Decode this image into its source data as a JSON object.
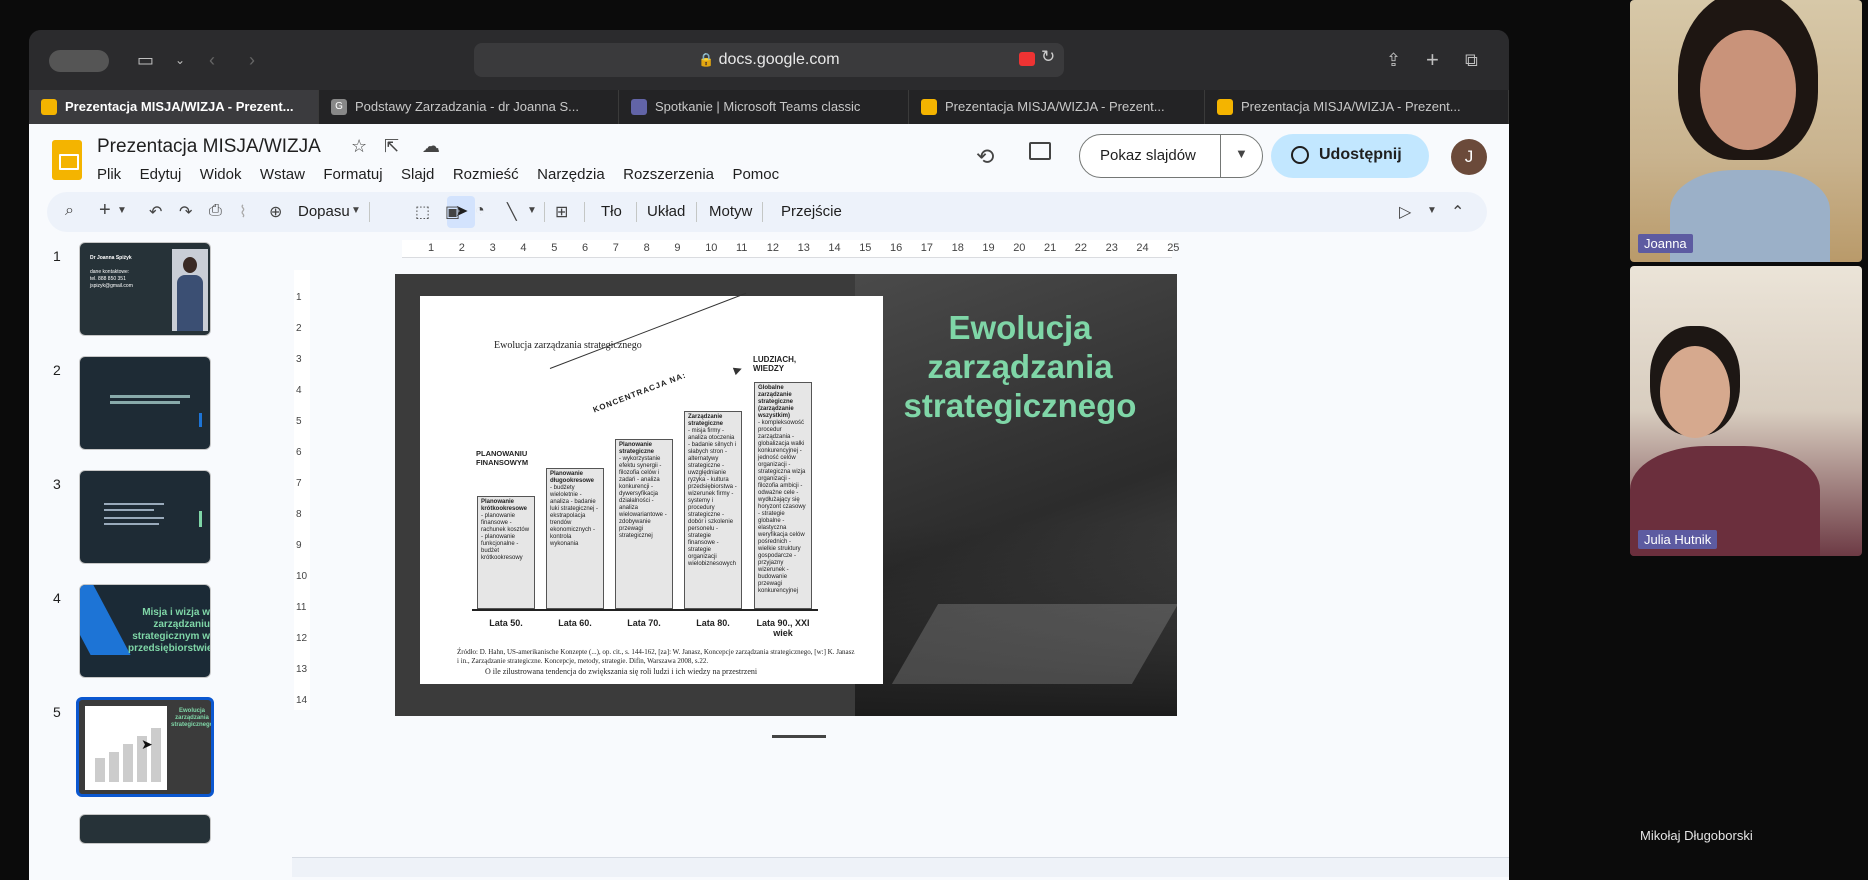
{
  "browser": {
    "url": "docs.google.com",
    "tabs": [
      {
        "label": "Prezentacja MISJA/WIZJA - Prezent...",
        "icon": "slides-icon",
        "active": true
      },
      {
        "label": "Podstawy Zarzadzania - dr Joanna S...",
        "icon": "g-icon",
        "active": false
      },
      {
        "label": "Spotkanie | Microsoft Teams classic",
        "icon": "teams-icon",
        "active": false
      },
      {
        "label": "Prezentacja MISJA/WIZJA - Prezent...",
        "icon": "slides-icon",
        "active": false
      },
      {
        "label": "Prezentacja MISJA/WIZJA - Prezent...",
        "icon": "slides-icon",
        "active": false
      }
    ]
  },
  "docs": {
    "title": "Prezentacja MISJA/WIZJA",
    "menu": [
      "Plik",
      "Edytuj",
      "Widok",
      "Wstaw",
      "Formatuj",
      "Slajd",
      "Rozmieść",
      "Narzędzia",
      "Rozszerzenia",
      "Pomoc"
    ],
    "slideshow_label": "Pokaz slajdów",
    "share_label": "Udostępnij",
    "avatar_initial": "J",
    "toolbar": {
      "zoom": "Dopasu",
      "background": "Tło",
      "layout": "Układ",
      "theme": "Motyw",
      "transition": "Przejście"
    }
  },
  "filmstrip": {
    "numbers": [
      "1",
      "2",
      "3",
      "4",
      "5"
    ],
    "slide1": {
      "name": "Dr Joanna Spiżyk",
      "contact_label": "dane kontaktowe:",
      "phone": "tel. 888 850 351",
      "email": "jspizyk@gmail.com"
    },
    "slide4": {
      "title": "Misja i wizja w zarządzaniu strategicznym w przedsiębiorstwie"
    },
    "slide5": {
      "title": "Ewolucja zarządzania strategicznego"
    }
  },
  "ruler": {
    "top": [
      "1",
      "2",
      "3",
      "4",
      "5",
      "6",
      "7",
      "8",
      "9",
      "10",
      "11",
      "12",
      "13",
      "14",
      "15",
      "16",
      "17",
      "18",
      "19",
      "20",
      "21",
      "22",
      "23",
      "24",
      "25"
    ],
    "left": [
      "1",
      "2",
      "3",
      "4",
      "5",
      "6",
      "7",
      "8",
      "9",
      "10",
      "11",
      "12",
      "13",
      "14"
    ]
  },
  "slide": {
    "title": "Ewolucja zarządzania strategicznego",
    "scan": {
      "heading": "Ewolucja zarządzania strategicznego",
      "top_right": "LUDZIACH, WIEDZY",
      "arrow_label": "KONCENTRACJA NA:",
      "left_label": "PLANOWANIU FINANSOWYM",
      "columns": [
        {
          "title": "Planowanie krótkookresowe",
          "items": "- planowanie finansowe - rachunek kosztów - planowanie funkcjonalne - budżet krótkookresowy",
          "era": "Lata 50."
        },
        {
          "title": "Planowanie długookresowe",
          "items": "- budżety wieloletnie - analiza - badanie luki strategicznej - ekstrapolacja trendów ekonomicznych - kontrola wykonania",
          "era": "Lata 60."
        },
        {
          "title": "Planowanie strategiczne",
          "items": "- wykorzystanie efektu synergii - filozofia celów i zadań - analiza konkurencji - dywersyfikacja działalności - analiza wielowariantowe - zdobywanie przewagi strategicznej",
          "era": "Lata 70."
        },
        {
          "title": "Zarządzanie strategiczne",
          "items": "- misja firmy - analiza otoczenia - badanie silnych i słabych stron - alternatywy strategiczne - uwzględnianie ryzyka - kultura przedsiębiorstwa - wizerunek firmy - systemy i procedury strategiczne - dobór i szkolenie personelu - strategie finansowe - strategie organizacji wielobiznesowych",
          "era": "Lata 80."
        },
        {
          "title": "Globalne zarządzanie strategiczne (zarządzanie wszystkim)",
          "items": "- kompleksowość procedur zarządzania - globalizacja walki konkurencyjnej - jedność celów organizacji - strategiczna wizja organizacji - filozofia ambicji - odważne cele - wydłużający się horyzont czasowy - strategie globalne - elastyczna weryfikacja celów pośrednich - wielkie struktury gospodarcze - przyjazny wizerunek - budowanie przewagi konkurencyjnej",
          "era": "Lata 90., XXI wiek"
        }
      ],
      "source": "Źródło: D. Hahn, US-amerikanische Konzepte (...), op. cit., s. 144-162, [za]: W. Janasz, Koncepcje zarządzania strategicznego, [w:] K. Janasz i in., Zarządzanie strategiczne. Koncepcje, metody, strategie. Difin, Warszawa 2008, s.22.",
      "body": "O ile zilustrowana tendencja do zwiększania się roli ludzi i ich wiedzy na przestrzeni"
    }
  },
  "participants": [
    {
      "name": "Joanna"
    },
    {
      "name": "Julia Hutnik"
    },
    {
      "name": "Mikołaj Długoborski"
    }
  ],
  "colors": {
    "accent": "#0b57d0",
    "slide_title": "#7fd6a7",
    "share_bg": "#c2e7ff",
    "teams_label": "#5d5ba1"
  }
}
